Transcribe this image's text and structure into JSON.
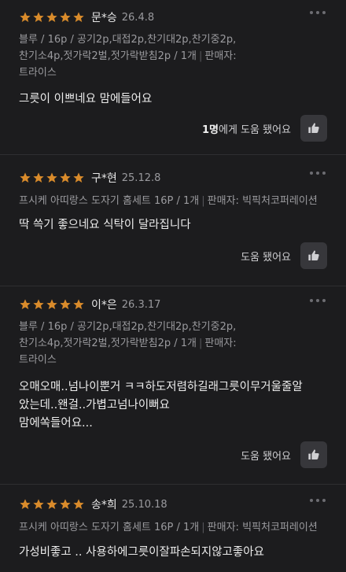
{
  "reviews": [
    {
      "name": "문*승",
      "date": "26.4.8",
      "option_line1": "블루 / 16p / 공기2p,대접2p,찬기대2p,찬기중2p,",
      "option_line2": "찬기소4p,젓가락2벌,젓가락받침2p / 1개",
      "option_seller_label": "판매자:",
      "option_line3": "트라이스",
      "text_lines": [
        "그릇이 이쁘네요 맘에들어요"
      ],
      "help_count": "1명",
      "help_suffix": "에게 도움 됐어요"
    },
    {
      "name": "구*현",
      "date": "25.12.8",
      "option_line1": "프시케 아띠랑스 도자기 홈세트 16P / 1개",
      "option_seller_label": "판매자: 빅픽처코퍼레이션",
      "text_lines": [
        "딱 쓱기 좋으네요 식탁이 달라집니다"
      ],
      "help_label": "도움 됐어요"
    },
    {
      "name": "이*은",
      "date": "26.3.17",
      "option_line1": "블루 / 16p / 공기2p,대접2p,찬기대2p,찬기중2p,",
      "option_line2": "찬기소4p,젓가락2벌,젓가락받침2p / 1개",
      "option_seller_label": "판매자:",
      "option_line3": "트라이스",
      "text_lines": [
        "오매오매..넘나이뿐거 ㅋㅋ하도저렴하길래그릇이무거울줄알",
        "았는데..왠걸..가볍고넘나이뻐요",
        "맘에쏙들어요..."
      ],
      "help_label": "도움 됐어요"
    },
    {
      "name": "송*희",
      "date": "25.10.18",
      "option_line1": "프시케 아띠랑스 도자기 홈세트 16P / 1개",
      "option_seller_label": "판매자: 빅픽처코퍼레이션",
      "text_lines": [
        "가성비좋고 .. 사용하에그릇이잘파손되지않고좋아요"
      ]
    }
  ],
  "icons": {
    "rating": "star-icon",
    "menu": "more-dots-icon",
    "helpful": "thumbs-up-icon"
  },
  "colors": {
    "background": "#1c1c1e",
    "star": "#d98b2b",
    "button": "#37373b"
  }
}
